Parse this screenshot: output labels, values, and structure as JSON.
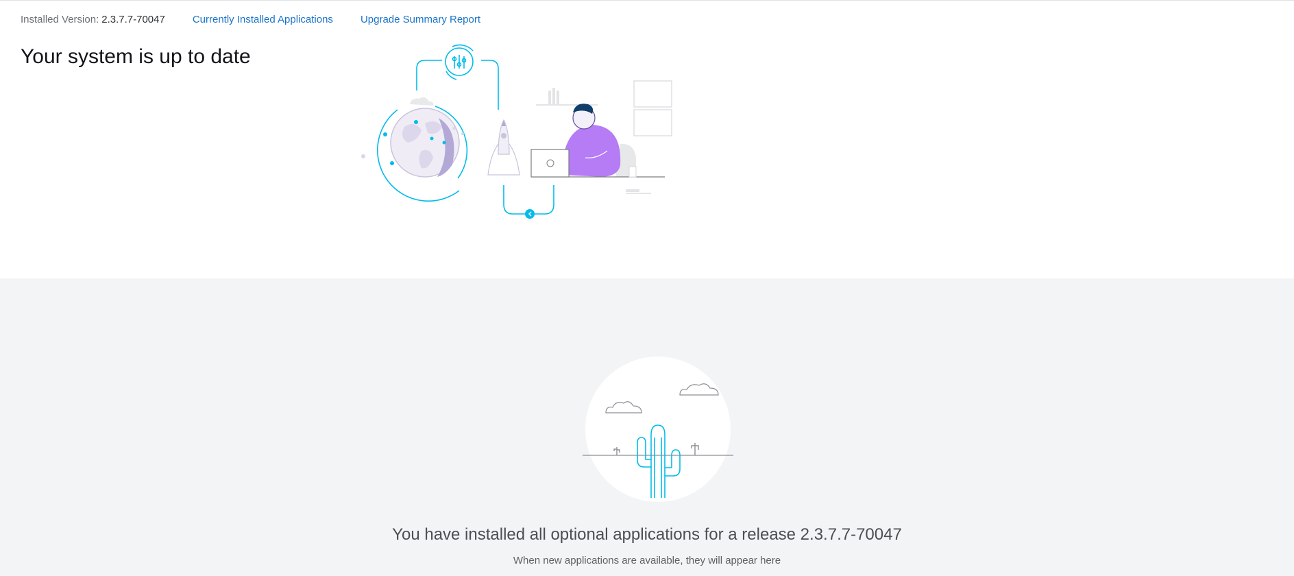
{
  "header": {
    "installed_version_label": "Installed Version:",
    "installed_version_value": "2.3.7.7-70047",
    "links": [
      {
        "label": "Currently Installed Applications"
      },
      {
        "label": "Upgrade Summary Report"
      }
    ]
  },
  "main": {
    "title": "Your system is up to date",
    "illustration_icon": "person-at-laptop-globe-rocket-illustration"
  },
  "optional_apps": {
    "title": "You have installed all optional applications for a release 2.3.7.7-70047",
    "subtitle": "When new applications are available, they will appear here",
    "illustration_icon": "desert-cactus-illustration"
  },
  "colors": {
    "link": "#1a73c9",
    "accent_teal": "#00bceb",
    "person_shirt": "#b57cf5",
    "lower_panel_bg": "#f3f4f5"
  }
}
